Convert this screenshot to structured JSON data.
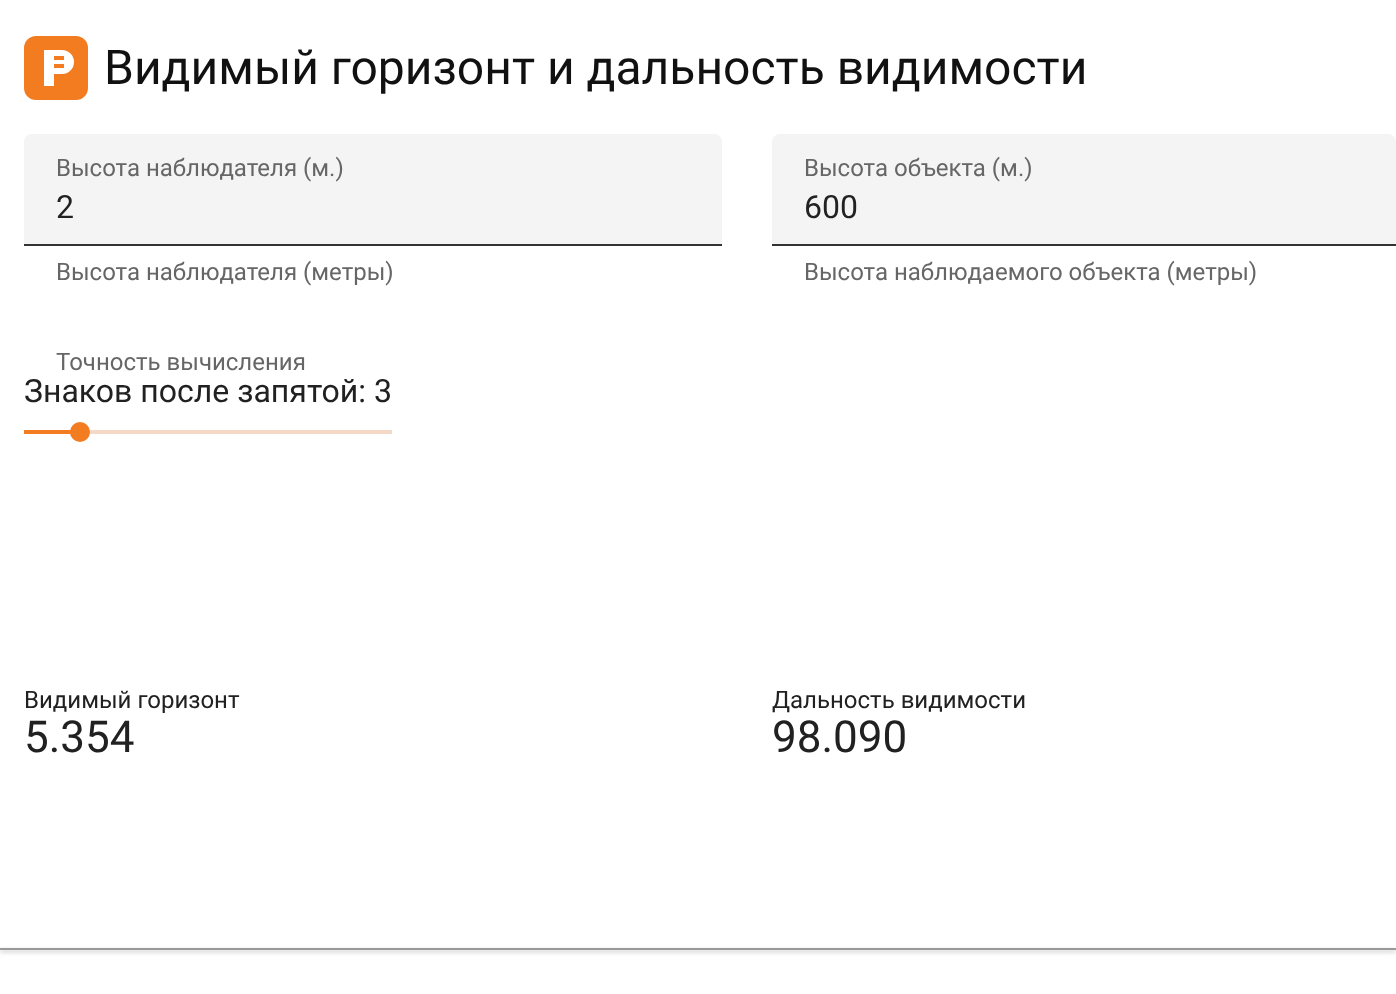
{
  "title": "Видимый горизонт и дальность видимости",
  "fields": [
    {
      "label": "Высота наблюдателя (м.)",
      "value": "2",
      "helper": "Высота наблюдателя (метры)"
    },
    {
      "label": "Высота объекта (м.)",
      "value": "600",
      "helper": "Высота наблюдаемого объекта (метры)"
    }
  ],
  "precision": {
    "label": "Точность вычисления",
    "reading": "Знаков после запятой: 3",
    "level": 0.15
  },
  "results": [
    {
      "label": "Видимый горизонт",
      "value": "5.354"
    },
    {
      "label": "Дальность видимости",
      "value": "98.090"
    }
  ]
}
